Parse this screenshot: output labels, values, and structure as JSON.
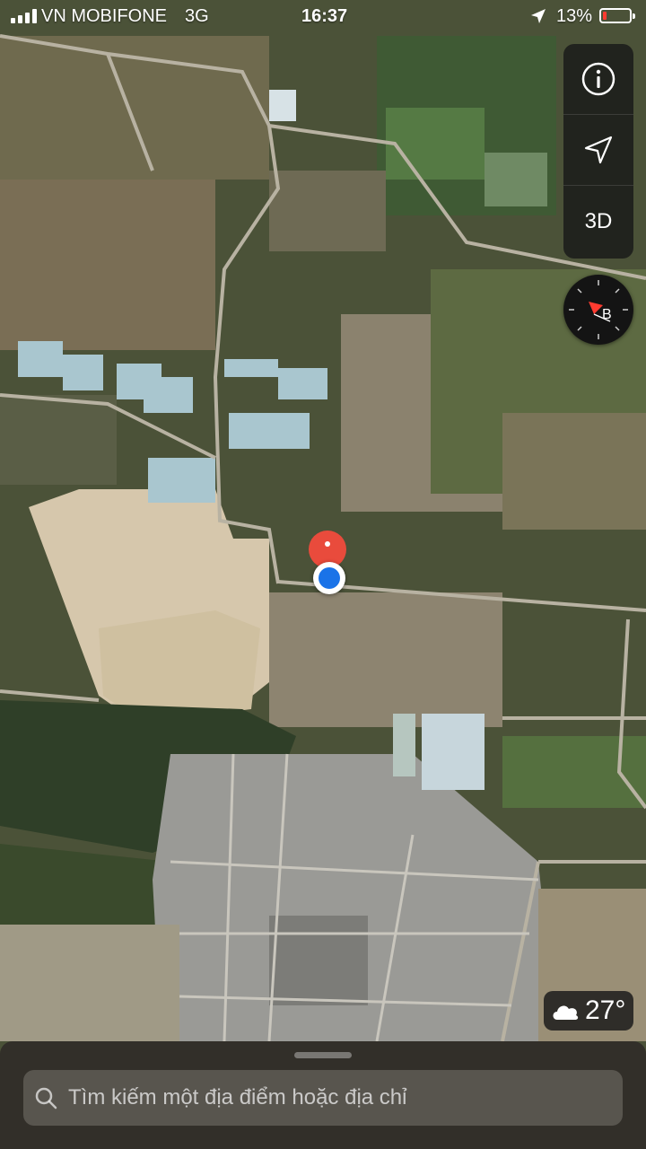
{
  "status_bar": {
    "carrier": "VN MOBIFONE",
    "network": "3G",
    "time": "16:37",
    "battery_percent": "13%",
    "battery_level": 0.13,
    "battery_color": "#ff3b30",
    "icons": [
      "signal-bars-icon",
      "location-arrow-icon",
      "battery-icon"
    ]
  },
  "map": {
    "type": "satellite",
    "controls": {
      "info_icon": "info-icon",
      "tracking_icon": "location-arrow-icon",
      "mode_label": "3D"
    },
    "compass": {
      "heading_label": "B"
    },
    "pin_color": "#e94b3c",
    "user_location_color": "#1a73e8"
  },
  "weather": {
    "icon": "cloud-icon",
    "temperature": "27°"
  },
  "bottom_sheet": {
    "search_placeholder": "Tìm kiếm một địa điểm hoặc địa chỉ",
    "search_icon": "search-icon"
  }
}
